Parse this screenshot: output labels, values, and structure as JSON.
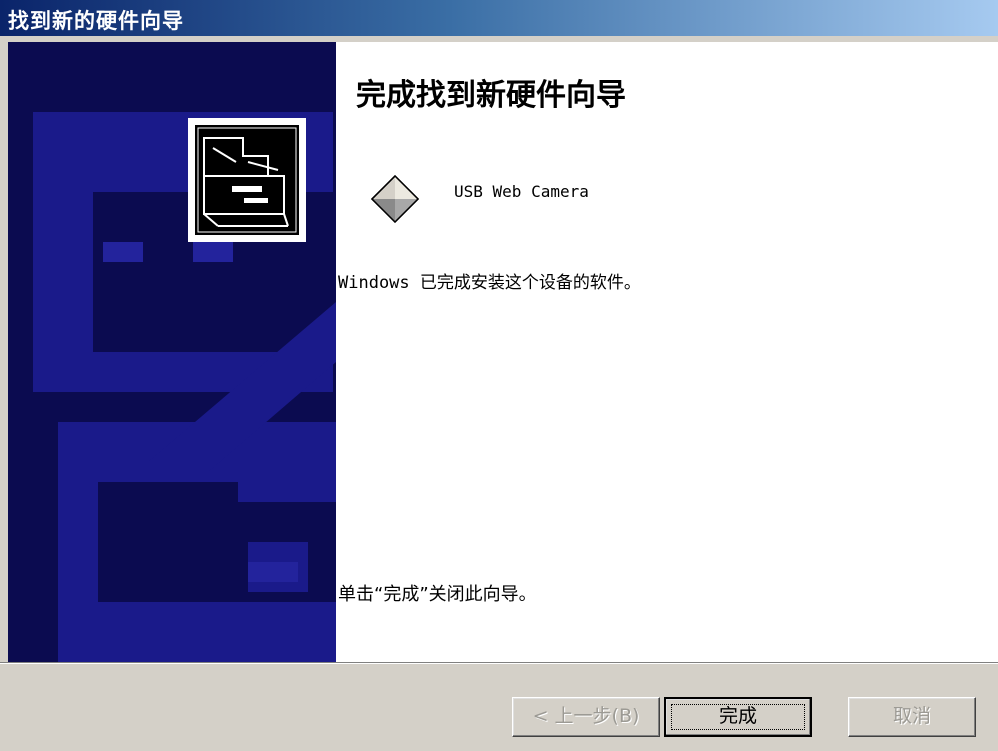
{
  "window": {
    "title": "找到新的硬件向导"
  },
  "content": {
    "heading": "完成找到新硬件向导",
    "device_name": "USB Web Camera",
    "device_icon": "usb-device-icon",
    "status_text": "Windows 已完成安装这个设备的软件。",
    "hint_text": "单击“完成”关闭此向导。"
  },
  "buttons": {
    "back": "< 上一步(B)",
    "finish": "完成",
    "cancel": "取消"
  },
  "colors": {
    "banner": "#0b0b50",
    "title_start": "#0a246a",
    "title_end": "#a6caf0"
  }
}
